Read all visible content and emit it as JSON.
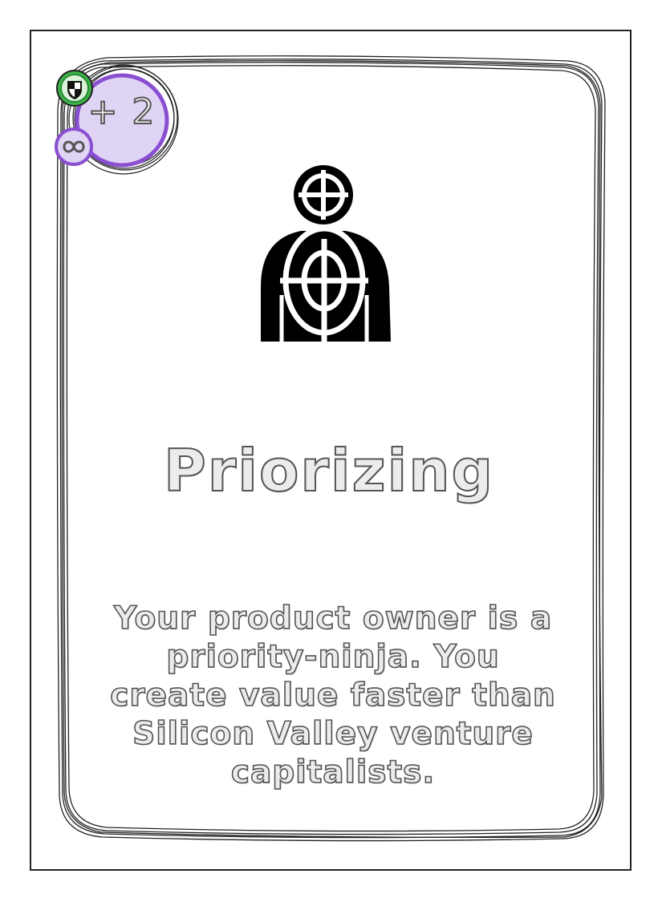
{
  "card": {
    "badge": {
      "value": "+ 2",
      "shield_icon": "shield-icon",
      "infinity_icon": "infinity-icon",
      "badge_fill_color": "#e0d4f5",
      "badge_ring_color": "#8a4fd1",
      "shield_color": "#3cb34a",
      "infinity_fill_color": "#e0d4f5"
    },
    "illustration_icon": "person-target-icon",
    "title": "Priorizing",
    "description": "Your product owner is a priority-ninja. You create value faster than Silicon Valley venture capitalists."
  }
}
